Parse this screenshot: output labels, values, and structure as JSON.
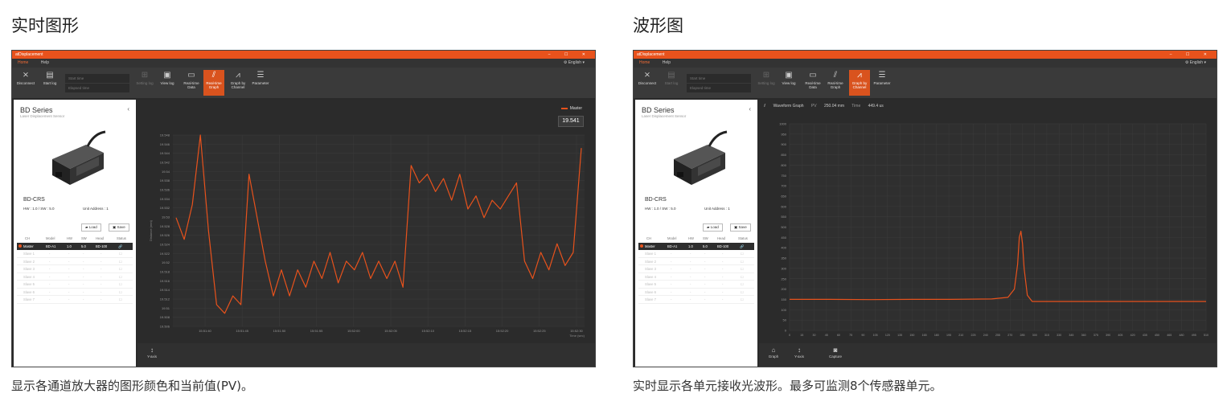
{
  "left": {
    "heading": "实时图形",
    "caption": "显示各通道放大器的图形颜色和当前值(PV)。"
  },
  "right": {
    "heading": "波形图",
    "caption": "实时显示各单元接收光波形。最多可监测8个传感器单元。"
  },
  "app": {
    "window_title": "atDisplacement",
    "window_controls": "– ☐ ✕",
    "menu": [
      "Home",
      "Help"
    ],
    "language": "English",
    "toolbar": {
      "disconnect": "Disconnect",
      "start_log": "Start log",
      "start_time": "Start time",
      "elapsed_time": "Elapsed time",
      "setting_log": "Setting log",
      "view_log": "View log",
      "realtime_data": "Real-time Data",
      "realtime_graph": "Real-time Graph",
      "graph_by_channel": "Graph by Channel",
      "parameter": "Parameter"
    },
    "sidebar": {
      "series": "BD Series",
      "subtitle": "Laser Displacement Sensor",
      "model": "BD-CRS",
      "version": "HW : 1.0 / SW : 5.0",
      "unit_address": "Unit Address : 1",
      "load": "Load",
      "save": "Save",
      "columns": [
        "CH",
        "Model",
        "HW",
        "SW",
        "Head",
        "Status"
      ],
      "master": [
        "Master",
        "BD-A1",
        "1.0",
        "5.0",
        "BD-100",
        "🔗"
      ],
      "slaves": [
        "Slave 1",
        "Slave 2",
        "Slave 3",
        "Slave 4",
        "Slave 5",
        "Slave 6",
        "Slave 7"
      ],
      "dash": "-"
    },
    "colors": {
      "accent": "#e8521c",
      "bg": "#2b2b2b",
      "toolbar": "#3a3a3a"
    }
  },
  "realtime": {
    "legend": "Master",
    "pv": "19.541",
    "yaxis_label": "Distance (mm)",
    "time_label": "Time (sec)",
    "bottom_yaxis": "Y-axis",
    "y_ticks": [
      "19.548",
      "19.546",
      "19.544",
      "19.542",
      "19.54",
      "19.538",
      "19.536",
      "19.534",
      "19.532",
      "19.53",
      "19.528",
      "19.526",
      "19.524",
      "19.522",
      "19.52",
      "19.518",
      "19.516",
      "19.514",
      "19.512",
      "19.51",
      "19.508",
      "19.506"
    ],
    "x_ticks": [
      "15:51:40",
      "15:51:45",
      "15:51:50",
      "15:51:55",
      "15:52:00",
      "15:52:05",
      "15:52:10",
      "15:52:15",
      "15:52:20",
      "15:52:25",
      "15:52:30"
    ]
  },
  "waveform": {
    "title": "Waveform Graph",
    "pv_label": "PV",
    "pv_value": "250.04 mm",
    "time_label": "Time",
    "time_value": "449.4 us",
    "bottom": {
      "graph": "Graph",
      "yaxis": "Y-axis",
      "capture": "Capture"
    },
    "y_ticks": [
      "1000",
      "950",
      "900",
      "850",
      "800",
      "750",
      "700",
      "650",
      "600",
      "550",
      "500",
      "450",
      "400",
      "350",
      "300",
      "250",
      "200",
      "150",
      "100",
      "50",
      "0"
    ],
    "x_ticks": [
      "0",
      "15",
      "30",
      "45",
      "60",
      "75",
      "90",
      "105",
      "120",
      "135",
      "150",
      "165",
      "180",
      "195",
      "210",
      "225",
      "240",
      "255",
      "270",
      "285",
      "300",
      "315",
      "330",
      "345",
      "360",
      "375",
      "390",
      "405",
      "420",
      "435",
      "450",
      "465",
      "480",
      "495",
      "510"
    ]
  },
  "chart_data": [
    {
      "type": "line",
      "series": [
        {
          "name": "Master",
          "color": "#e8521c",
          "x": [
            0,
            0.02,
            0.04,
            0.06,
            0.08,
            0.1,
            0.12,
            0.14,
            0.16,
            0.18,
            0.2,
            0.22,
            0.24,
            0.26,
            0.28,
            0.3,
            0.32,
            0.34,
            0.36,
            0.38,
            0.4,
            0.42,
            0.44,
            0.46,
            0.48,
            0.5,
            0.52,
            0.54,
            0.56,
            0.58,
            0.6,
            0.62,
            0.64,
            0.66,
            0.68,
            0.7,
            0.72,
            0.74,
            0.76,
            0.78,
            0.8,
            0.82,
            0.84,
            0.86,
            0.88,
            0.9,
            0.92,
            0.94,
            0.96,
            0.98,
            1
          ],
          "values": [
            19.53,
            19.525,
            19.533,
            19.549,
            19.527,
            19.51,
            19.508,
            19.512,
            19.51,
            19.54,
            19.53,
            19.52,
            19.512,
            19.518,
            19.512,
            19.518,
            19.514,
            19.52,
            19.516,
            19.522,
            19.515,
            19.52,
            19.518,
            19.522,
            19.516,
            19.52,
            19.516,
            19.52,
            19.514,
            19.542,
            19.538,
            19.54,
            19.536,
            19.539,
            19.534,
            19.54,
            19.532,
            19.535,
            19.53,
            19.534,
            19.532,
            19.535,
            19.538,
            19.52,
            19.516,
            19.522,
            19.518,
            19.524,
            19.519,
            19.522,
            19.546
          ]
        }
      ],
      "ylim": [
        19.505,
        19.549
      ],
      "ylabel": "Distance (mm)",
      "xlabel": "Time (sec)",
      "grid": true,
      "legend": "top-right"
    },
    {
      "type": "line",
      "series": [
        {
          "name": "",
          "color": "#e8521c",
          "x": [
            0,
            50,
            100,
            150,
            200,
            250,
            270,
            278,
            282,
            284,
            286,
            288,
            290,
            294,
            300,
            320,
            350,
            400,
            450,
            500,
            515
          ],
          "values": [
            150,
            150,
            149,
            150,
            150,
            152,
            160,
            200,
            320,
            450,
            480,
            420,
            300,
            170,
            140,
            140,
            140,
            140,
            140,
            140,
            140
          ]
        }
      ],
      "xlim": [
        0,
        515
      ],
      "ylim": [
        0,
        1000
      ],
      "grid": true
    }
  ]
}
